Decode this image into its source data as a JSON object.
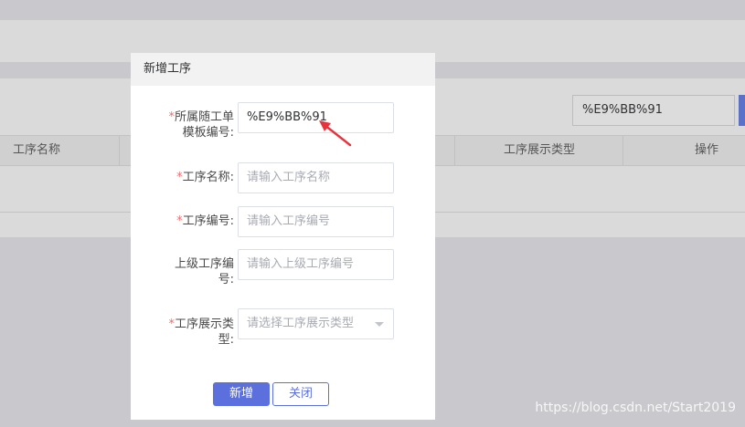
{
  "background": {
    "search_value": "%E9%BB%91",
    "table_headers": [
      "工序名称",
      "工序展示类型",
      "操作"
    ]
  },
  "dialog": {
    "title": "新增工序",
    "fields": [
      {
        "label_line1": "所属随工单",
        "label_line2": "模板编号:",
        "value": "%E9%BB%91",
        "required": "*"
      },
      {
        "label": "工序名称:",
        "placeholder": "请输入工序名称",
        "required": "*"
      },
      {
        "label": "工序编号:",
        "placeholder": "请输入工序编号",
        "required": "*"
      },
      {
        "label_line1": "上级工序编",
        "label_line2": "号:",
        "placeholder": "请输入上级工序编号"
      },
      {
        "label_line1": "工序展示类",
        "label_line2": "型:",
        "placeholder": "请选择工序展示类型",
        "required": "*"
      }
    ],
    "buttons": {
      "submit": "新增",
      "close": "关闭"
    }
  },
  "watermark": "https://blog.csdn.net/Start2019",
  "colors": {
    "primary": "#5b70dc",
    "required": "#f56c6c",
    "annotation": "#e8323c"
  }
}
